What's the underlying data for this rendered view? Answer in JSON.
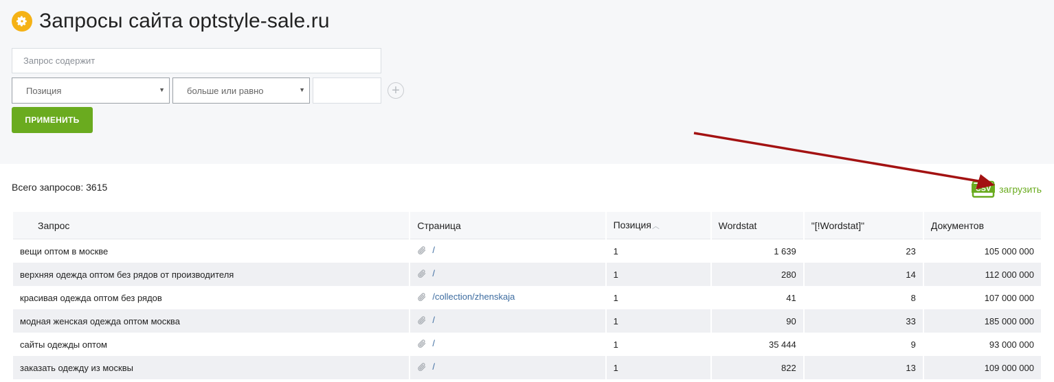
{
  "page": {
    "title": "Запросы сайта optstyle-sale.ru",
    "title_icon": "gear-icon",
    "accent_color": "#6aab1f"
  },
  "filters": {
    "query_placeholder": "Запрос содержит",
    "field_select": "Позиция",
    "operator_select": "больше или равно",
    "value": "",
    "apply_label": "ПРИМЕНИТЬ"
  },
  "summary": {
    "total_label": "Всего запросов: 3615"
  },
  "export": {
    "icon": "csv-icon",
    "label": "загрузить"
  },
  "table": {
    "columns": [
      "Запрос",
      "Страница",
      "Позиция",
      "Wordstat",
      "\"[!Wordstat]\"",
      "Документов"
    ],
    "sorted_column": "Позиция",
    "rows": [
      {
        "query": "вещи оптом в москве",
        "page": "/",
        "position": "1",
        "wordstat": "1 639",
        "exact": "23",
        "docs": "105 000 000"
      },
      {
        "query": "верхняя одежда оптом без рядов от производителя",
        "page": "/",
        "position": "1",
        "wordstat": "280",
        "exact": "14",
        "docs": "112 000 000"
      },
      {
        "query": "красивая одежда оптом без рядов",
        "page": "/collection/zhenskaja",
        "position": "1",
        "wordstat": "41",
        "exact": "8",
        "docs": "107 000 000"
      },
      {
        "query": "модная женская одежда оптом москва",
        "page": "/",
        "position": "1",
        "wordstat": "90",
        "exact": "33",
        "docs": "185 000 000"
      },
      {
        "query": "сайты одежды оптом",
        "page": "/",
        "position": "1",
        "wordstat": "35 444",
        "exact": "9",
        "docs": "93 000 000"
      },
      {
        "query": "заказать одежду из москвы",
        "page": "/",
        "position": "1",
        "wordstat": "822",
        "exact": "13",
        "docs": "109 000 000"
      }
    ]
  }
}
